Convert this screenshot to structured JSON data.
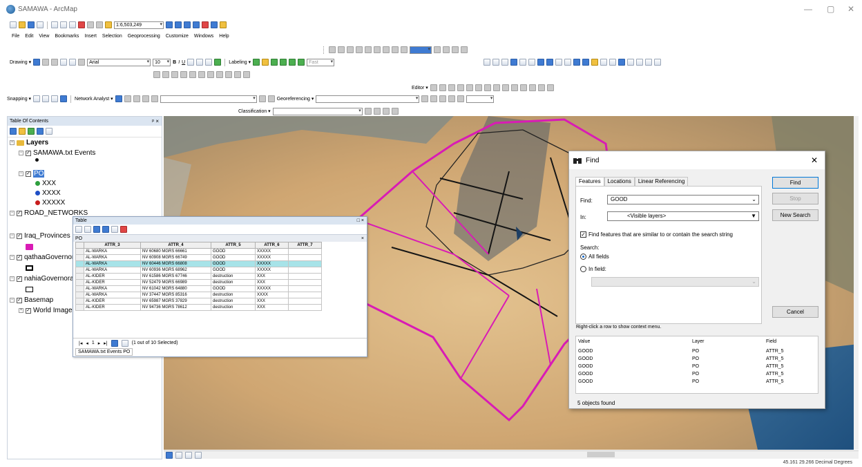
{
  "window": {
    "app_title": "SAMAWA - ArcMap",
    "minimize": "—",
    "restore": "▢",
    "close": "✕"
  },
  "toolbar": {
    "scale": "1:6,503,249"
  },
  "menu": [
    "File",
    "Edit",
    "View",
    "Bookmarks",
    "Insert",
    "Selection",
    "Geoprocessing",
    "Customize",
    "Windows",
    "Help"
  ],
  "drawing": {
    "label": "Drawing ▾",
    "font": "Arial",
    "size": "10",
    "labeling": "Labeling ▾",
    "fast": "Fast"
  },
  "editor": {
    "label": "Editor ▾"
  },
  "snapping": {
    "label": "Snapping ▾",
    "network": "Network Analyst ▾",
    "georef": "Georeferencing ▾"
  },
  "classification": {
    "label": "Classification ▾"
  },
  "toc": {
    "title": "Table Of Contents",
    "close": "ᵖ ×",
    "layers_root": "Layers",
    "items": [
      {
        "label": "SAMAWA.txt Events"
      },
      {
        "label": "PO"
      },
      {
        "label": "XXX",
        "color": "#2e9f3e"
      },
      {
        "label": "XXXX",
        "color": "#1f4fc6"
      },
      {
        "label": "XXXXX",
        "color": "#c81d1d"
      },
      {
        "label": "ROAD_NETWORKS"
      },
      {
        "label": "Iraq_Provinces"
      },
      {
        "label": "qathaaGovernorates"
      },
      {
        "label": "nahiaGovernorates"
      },
      {
        "label": "Basemap"
      },
      {
        "label": "World Imagery"
      }
    ]
  },
  "table": {
    "window_title": "Table",
    "layer_tab": "PO",
    "close": "×",
    "columns": [
      "ATTR_3",
      "ATTR_4",
      "ATTR_5",
      "ATTR_6",
      "ATTR_7"
    ],
    "rows": [
      [
        "AL-WARKA",
        "NV 60680 MGRS 66661",
        "GOOD",
        "XXXXX",
        ""
      ],
      [
        "AL-WARKA",
        "NV 60908 MGRS 66749",
        "GOOD",
        "XXXXX",
        ""
      ],
      [
        "AL-WARKA",
        "NV 60446 MGRS 66808",
        "GOOD",
        "XXXXX",
        ""
      ],
      [
        "AL-WARKA",
        "NV 60936 MGRS 68962",
        "GOOD",
        "XXXXX",
        ""
      ],
      [
        "AL-KIDER",
        "NV 61586 MGRS 67746",
        "destruction",
        "XXX",
        ""
      ],
      [
        "AL-KIDER",
        "NV 52479 MGRS 66989",
        "destruction",
        "XXX",
        ""
      ],
      [
        "AL-WARKA",
        "NV 61042 MGRS 64880",
        "GOOD",
        "XXXXX",
        ""
      ],
      [
        "AL-WARKA",
        "NV 37447 MGRS 85316",
        "destruction",
        "XXXX",
        ""
      ],
      [
        "AL-KIDER",
        "NV 65987 MGRS 37829",
        "destruction",
        "XXX",
        ""
      ],
      [
        "AL-KIDER",
        "NV 94736 MGRS 78612",
        "destruction",
        "XXX",
        ""
      ]
    ],
    "selected_row": 2,
    "record": "1",
    "selection_status": "(1 out of 10 Selected)",
    "bottom_tabs": "SAMAWA.txt Events  PO"
  },
  "find": {
    "title": "Find",
    "tabs": [
      "Features",
      "Locations",
      "Linear Referencing"
    ],
    "find_label": "Find:",
    "find_value": "GOOD",
    "in_label": "In:",
    "in_value": "<Visible layers>",
    "similar_check": "Find features that are similar to or contain the search string",
    "search_label": "Search:",
    "all_fields": "All fields",
    "in_field": "In field:",
    "btn_find": "Find",
    "btn_stop": "Stop",
    "btn_new": "New Search",
    "btn_cancel": "Cancel",
    "context_hint": "Right-click a row to show context menu.",
    "result_headers": [
      "Value",
      "Layer",
      "Field"
    ],
    "results": [
      [
        "GOOD",
        "PO",
        "ATTR_5"
      ],
      [
        "GOOD",
        "PO",
        "ATTR_5"
      ],
      [
        "GOOD",
        "PO",
        "ATTR_5"
      ],
      [
        "GOOD",
        "PO",
        "ATTR_5"
      ],
      [
        "GOOD",
        "PO",
        "ATTR_5"
      ]
    ],
    "footer": "5 objects found"
  },
  "status": {
    "coords": "45.161  29.266 Decimal Degrees"
  }
}
